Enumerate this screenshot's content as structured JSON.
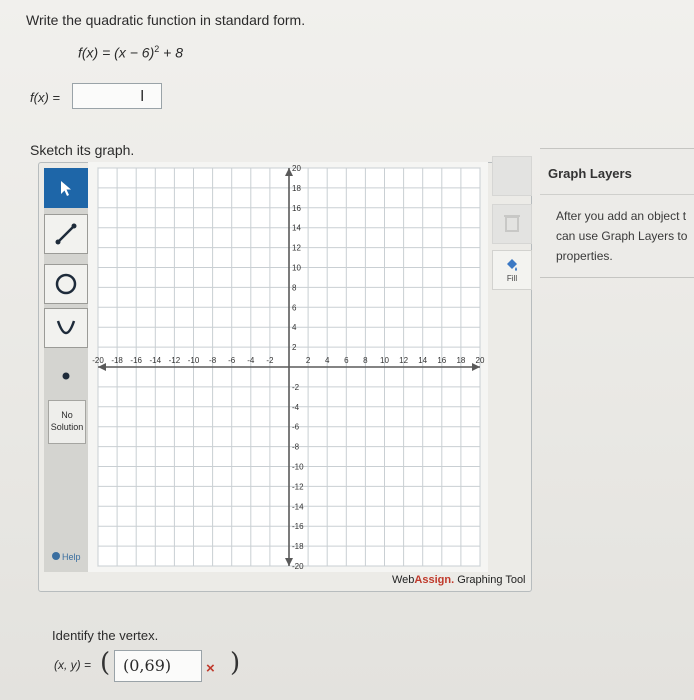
{
  "problem": {
    "instruction": "Write the quadratic function in standard form.",
    "given_lhs": "f(x) = (x − 6)",
    "given_exp": "2",
    "given_rhs": " + 8",
    "answer_label": "f(x) =",
    "answer_value": ""
  },
  "sketch_prompt": "Sketch its graph.",
  "graph": {
    "x_ticks": [
      "-20",
      "-18",
      "-16",
      "-14",
      "-12",
      "-10",
      "-8",
      "-6",
      "-4",
      "-2",
      "2",
      "4",
      "6",
      "8",
      "10",
      "12",
      "14",
      "16",
      "18",
      "20"
    ],
    "y_ticks": [
      "20",
      "18",
      "16",
      "14",
      "12",
      "10",
      "8",
      "6",
      "4",
      "2",
      "-2",
      "-4",
      "-6",
      "-8",
      "-10",
      "-12",
      "-14",
      "-16",
      "-18",
      "-20"
    ],
    "x_range": [
      -20,
      20
    ],
    "y_range": [
      -20,
      20
    ],
    "grid": true
  },
  "tools": {
    "no_solution_line1": "No",
    "no_solution_line2": "Solution",
    "help": "Help",
    "fill": "Fill"
  },
  "brand": {
    "prefix": "Web",
    "name": "Assign.",
    "suffix": " Graphing Tool"
  },
  "layers": {
    "title": "Graph Layers",
    "line1": "After you add an object t",
    "line2": "can use Graph Layers to",
    "line3": "properties."
  },
  "vertex": {
    "label": "Identify the vertex.",
    "prefix": "(x, y) =",
    "value": "(0,69)",
    "status": "×"
  },
  "colors": {
    "selected_tool": "#1e66a8",
    "incorrect": "#c0392b",
    "axis": "#5a5a5a",
    "grid": "#c9cfd3"
  }
}
